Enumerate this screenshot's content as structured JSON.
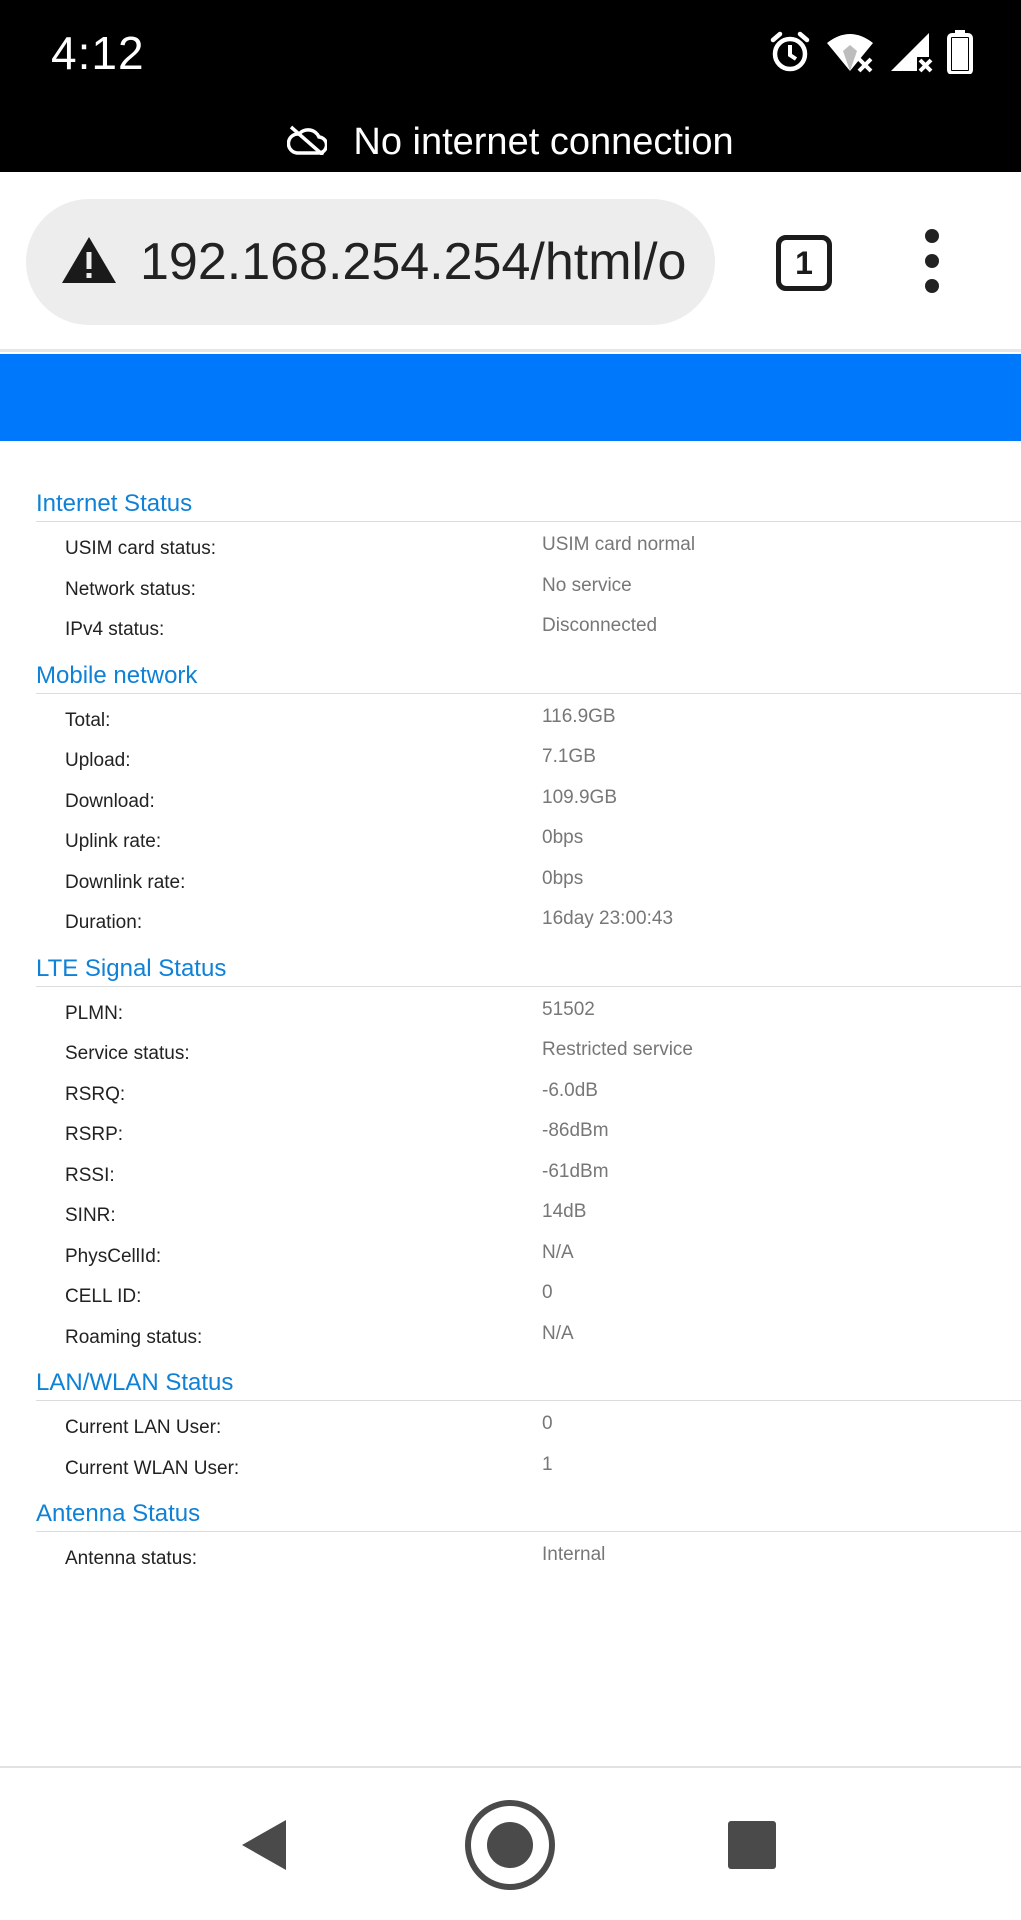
{
  "status_bar": {
    "time": "4:12",
    "icons": [
      "alarm-icon",
      "wifi-off-icon",
      "signal-icon",
      "battery-icon"
    ],
    "offline_message": "No internet connection",
    "offline_icon": "cloud-off-icon"
  },
  "browser": {
    "url": "192.168.254.254/html/o",
    "security_icon": "warning-icon",
    "tab_count": "1",
    "menu_icon": "more-vert-icon"
  },
  "colors": {
    "header_band": "#0078fc",
    "section_title": "#0f81d6",
    "value_text": "#777777"
  },
  "sections": [
    {
      "title": "Internet Status",
      "rows": [
        {
          "label": "USIM card status:",
          "value": "USIM card normal"
        },
        {
          "label": "Network status:",
          "value": "No service"
        },
        {
          "label": "IPv4 status:",
          "value": "Disconnected"
        }
      ]
    },
    {
      "title": "Mobile network",
      "rows": [
        {
          "label": "Total:",
          "value": "116.9GB"
        },
        {
          "label": "Upload:",
          "value": "7.1GB"
        },
        {
          "label": "Download:",
          "value": "109.9GB"
        },
        {
          "label": "Uplink rate:",
          "value": "0bps"
        },
        {
          "label": "Downlink rate:",
          "value": "0bps"
        },
        {
          "label": "Duration:",
          "value": "16day 23:00:43"
        }
      ]
    },
    {
      "title": "LTE Signal Status",
      "rows": [
        {
          "label": "PLMN:",
          "value": "51502"
        },
        {
          "label": "Service status:",
          "value": "Restricted service"
        },
        {
          "label": "RSRQ:",
          "value": "-6.0dB"
        },
        {
          "label": "RSRP:",
          "value": "-86dBm"
        },
        {
          "label": "RSSI:",
          "value": "-61dBm"
        },
        {
          "label": "SINR:",
          "value": "14dB"
        },
        {
          "label": "PhysCellId:",
          "value": "N/A"
        },
        {
          "label": "CELL ID:",
          "value": "0"
        },
        {
          "label": "Roaming status:",
          "value": "N/A"
        }
      ]
    },
    {
      "title": "LAN/WLAN Status",
      "rows": [
        {
          "label": "Current LAN User:",
          "value": "0"
        },
        {
          "label": "Current WLAN User:",
          "value": "1"
        }
      ]
    },
    {
      "title": "Antenna Status",
      "rows": [
        {
          "label": "Antenna status:",
          "value": "Internal"
        }
      ]
    }
  ],
  "nav_bar": {
    "buttons": [
      "back-icon",
      "home-icon",
      "recents-icon"
    ]
  }
}
